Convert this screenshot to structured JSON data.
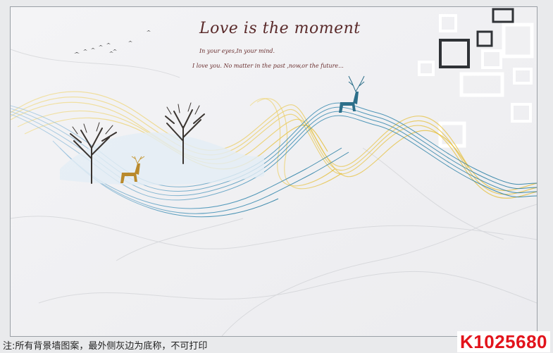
{
  "artwork": {
    "headline": "Love is the moment",
    "line1": "In your eyes,In your mind.",
    "line2": "I love you. No matter in the past ,now,or the future..."
  },
  "footer": {
    "note": "注:所有背景墙图案，最外侧灰边为底称，不可打印",
    "code": "K1025680"
  },
  "colors": {
    "gold_ribbon": "#e3b92a",
    "blue_ribbon": "#3f8fb5",
    "code_red": "#e2131b"
  }
}
